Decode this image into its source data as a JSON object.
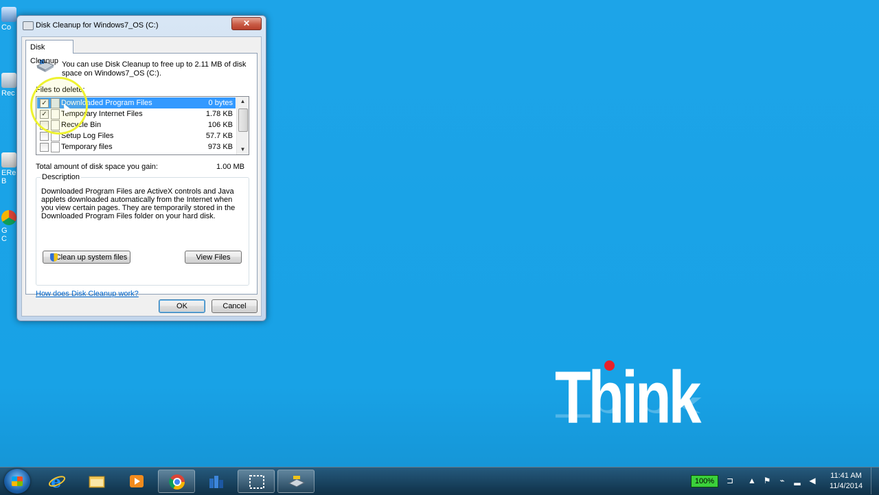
{
  "desktop": {
    "icons": [
      {
        "label": "Co",
        "icon": "computer-icon"
      },
      {
        "label": "Rec",
        "icon": "recycle-bin-icon"
      },
      {
        "label": "ERe\nB",
        "icon": "lock-icon"
      },
      {
        "label": "G\nC",
        "icon": "chrome-icon"
      }
    ],
    "logo": {
      "word": "Think",
      "dot_color": "#e8202a"
    }
  },
  "dialog": {
    "title": "Disk Cleanup for Windows7_OS (C:)",
    "close_label": "✕",
    "tab_label": "Disk Cleanup",
    "intro": "You can use Disk Cleanup to free up to 2.11 MB of disk space on Windows7_OS (C:).",
    "files_to_delete_label": "Files to delete:",
    "files": [
      {
        "name": "Downloaded Program Files",
        "size": "0 bytes",
        "checked": true,
        "selected": true
      },
      {
        "name": "Temporary Internet Files",
        "size": "1.78 KB",
        "checked": true,
        "selected": false
      },
      {
        "name": "Recycle Bin",
        "size": "106 KB",
        "checked": false,
        "selected": false
      },
      {
        "name": "Setup Log Files",
        "size": "57.7 KB",
        "checked": false,
        "selected": false
      },
      {
        "name": "Temporary files",
        "size": "973 KB",
        "checked": false,
        "selected": false
      }
    ],
    "total_label": "Total amount of disk space you gain:",
    "total_value": "1.00 MB",
    "description_title": "Description",
    "description_text": "Downloaded Program Files are ActiveX controls and Java applets downloaded automatically from the Internet when you view certain pages. They are temporarily stored in the Downloaded Program Files folder on your hard disk.",
    "cleanup_system_label": "Clean up system files",
    "view_files_label": "View Files",
    "help_link": "How does Disk Cleanup work?",
    "ok_label": "OK",
    "cancel_label": "Cancel"
  },
  "taskbar": {
    "apps": [
      {
        "name": "internet-explorer-icon",
        "active": false
      },
      {
        "name": "file-explorer-icon",
        "active": false
      },
      {
        "name": "media-player-icon",
        "active": false
      },
      {
        "name": "chrome-icon",
        "active": true
      },
      {
        "name": "app-icon",
        "active": false
      },
      {
        "name": "snipping-tool-icon",
        "active": true
      },
      {
        "name": "disk-cleanup-icon",
        "active": true
      }
    ],
    "battery": "100%",
    "time": "11:41 AM",
    "date": "11/4/2014"
  }
}
